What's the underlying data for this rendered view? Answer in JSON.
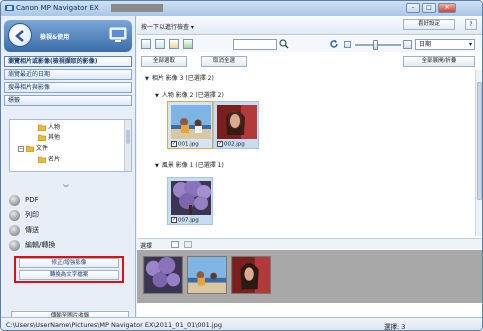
{
  "window": {
    "title": "Canon MP Navigator EX",
    "controls": {
      "help": "?",
      "minimize": "–",
      "maximize": "□",
      "close": "✕"
    }
  },
  "left_panel": {
    "mode_label": "檢視&使用",
    "nav_items": [
      "瀏覽相片或影像(檢視擷取的影像)",
      "瀏覽最近的日期",
      "搜尋相片與影像",
      "標籤"
    ],
    "tree": [
      {
        "label": "人物",
        "indent": 2
      },
      {
        "label": "其他",
        "indent": 2
      },
      {
        "label": "文件",
        "indent": 1
      },
      {
        "label": "名片",
        "indent": 2
      }
    ],
    "actions": [
      "PDF",
      "列印",
      "傳送",
      "編輯/轉換"
    ],
    "sub_buttons": [
      "修正/增強影像",
      "轉換為文字檔案"
    ],
    "import_button": "傳輸至圖片收錄"
  },
  "right_panel": {
    "header_label": "按一下以進行檢查 ▾",
    "preferences_button": "喜好設定",
    "help_button": "?",
    "search_placeholder": "",
    "sort_value": "日期",
    "select_all_button": "全部選取",
    "deselect_all_button": "取消全選",
    "expand_button": "全部展開/折疊",
    "groups": [
      {
        "title": "相片 影像 3 (已選擇 2)",
        "level": 0
      },
      {
        "title": "人物 影像 2 (已選擇 2)",
        "level": 1
      },
      {
        "title": "風景 影像 1 (已選擇 1)",
        "level": 1
      }
    ],
    "thumbnails": [
      {
        "caption": "001.jpg",
        "checked": true,
        "selected": true
      },
      {
        "caption": "002.jpg",
        "checked": true,
        "selected": false
      },
      {
        "caption": "007.jpg",
        "checked": true,
        "selected": false
      }
    ],
    "selection_label": "選擇",
    "selection_count": 3
  },
  "status_bar": {
    "path": "C:\\Users\\UserName\\Pictures\\MP Navigator EX\\2011_01_01\\001.jpg",
    "count_label": "選擇: 3"
  }
}
